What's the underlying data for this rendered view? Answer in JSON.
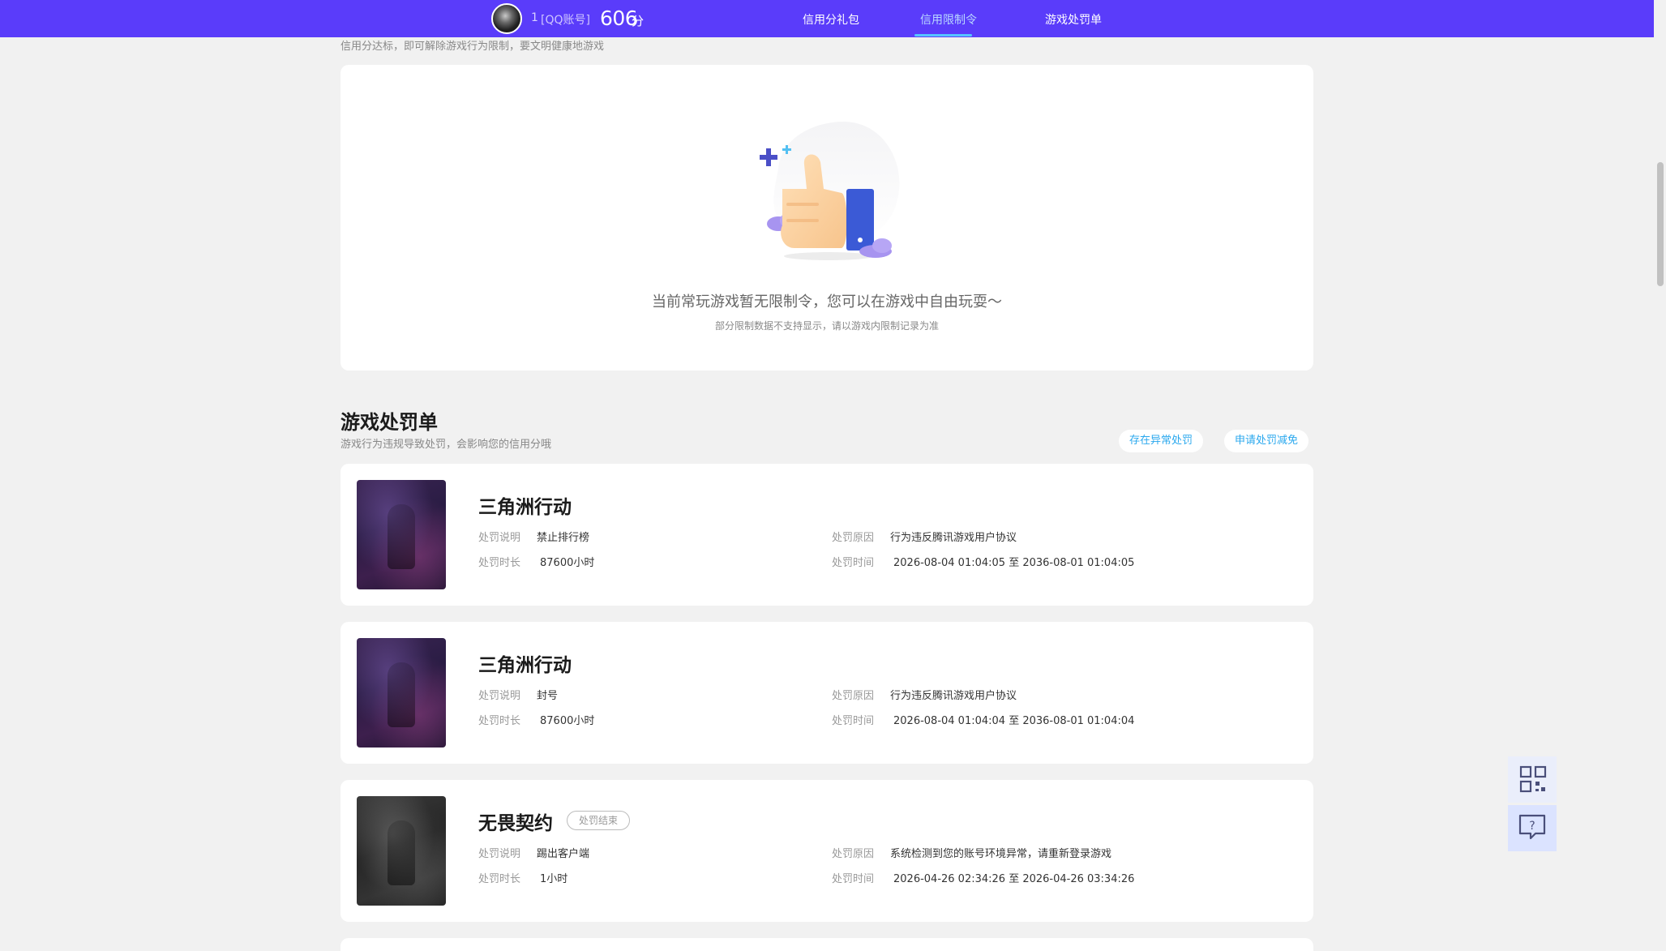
{
  "header": {
    "account_name": "1",
    "account_type": "[QQ账号]",
    "score": "606",
    "score_unit": "分",
    "nav": [
      {
        "label": "信用分礼包",
        "active": false
      },
      {
        "label": "信用限制令",
        "active": true
      },
      {
        "label": "游戏处罚单",
        "active": false
      }
    ]
  },
  "restriction": {
    "subtitle": "信用分达标，即可解除游戏行为限制，要文明健康地游戏",
    "empty_title": "当前常玩游戏暂无限制令，您可以在游戏中自由玩耍～",
    "empty_note": "部分限制数据不支持显示，请以游戏内限制记录为准"
  },
  "penalties": {
    "title": "游戏处罚单",
    "subtitle": "游戏行为违规导致处罚，会影响您的信用分哦",
    "buttons": {
      "abnormal": "存在异常处罚",
      "reduce": "申请处罚减免"
    },
    "labels": {
      "desc": "处罚说明",
      "duration": "处罚时长",
      "reason": "处罚原因",
      "time": "处罚时间"
    },
    "items": [
      {
        "game": "三角洲行动",
        "status": "",
        "desc": "禁止排行榜",
        "duration": "87600小时",
        "reason": "行为违反腾讯游戏用户协议",
        "time": "2026-08-04 01:04:05 至 2036-08-01 01:04:05"
      },
      {
        "game": "三角洲行动",
        "status": "",
        "desc": "封号",
        "duration": "87600小时",
        "reason": "行为违反腾讯游戏用户协议",
        "time": "2026-08-04 01:04:04 至 2036-08-01 01:04:04"
      },
      {
        "game": "无畏契约",
        "status": "处罚结束",
        "desc": "踢出客户端",
        "duration": "1小时",
        "reason": "系统检测到您的账号环境异常，请重新登录游戏",
        "time": "2026-04-26 02:34:26 至 2026-04-26 03:34:26"
      }
    ]
  },
  "icons": {
    "qr": "qr-code-icon",
    "help": "help-chat-icon"
  },
  "colors": {
    "brand": "#5a3cfa",
    "accent": "#2aa8ee",
    "active_nav": "#b9d8ff"
  }
}
